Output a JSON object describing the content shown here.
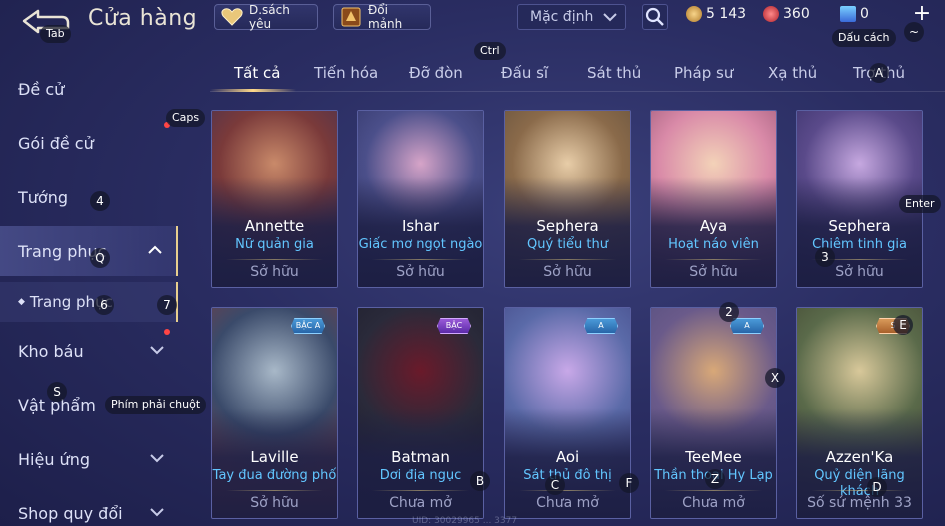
{
  "header": {
    "title": "Cửa hàng",
    "wishlist_label": "D.sách yêu",
    "fragments_label": "Đổi mảnh",
    "sort_value": "Mặc định",
    "currencies": {
      "gold": "5 143",
      "ruby": "360",
      "voucher": "0"
    },
    "plus": "+"
  },
  "tabs": [
    "Tất cả",
    "Tiến hóa",
    "Đỡ đòn",
    "Đấu sĩ",
    "Sát thủ",
    "Pháp sư",
    "Xạ thủ",
    "Trợ thủ"
  ],
  "sidebar": {
    "items": [
      "Đề cử",
      "Gói đề cử",
      "Tướng",
      "Trang phục",
      "Trang phục",
      "Kho báu",
      "Vật phẩm",
      "Hiệu ứng",
      "Shop quy đổi"
    ]
  },
  "cards": [
    {
      "hero": "Annette",
      "skin": "Nữ quản gia",
      "status": "Sở hữu",
      "colors": [
        "#7a3a3a",
        "#c98a6a",
        "#3a2f55"
      ]
    },
    {
      "hero": "Ishar",
      "skin": "Giấc mơ ngọt ngào",
      "status": "Sở hữu",
      "colors": [
        "#4b4f8a",
        "#d6a4c8",
        "#2b2f60"
      ]
    },
    {
      "hero": "Sephera",
      "skin": "Quý tiểu thư",
      "status": "Sở hữu",
      "colors": [
        "#8a6a4a",
        "#e8cda8",
        "#5a4a3a"
      ]
    },
    {
      "hero": "Aya",
      "skin": "Hoạt náo viên",
      "status": "Sở hữu",
      "colors": [
        "#d98aa8",
        "#f3d2b8",
        "#8a4a6a"
      ]
    },
    {
      "hero": "Sephera",
      "skin": "Chiêm tinh gia",
      "status": "Sở hữu",
      "colors": [
        "#5a4a8a",
        "#c6a8e0",
        "#2f2a60"
      ]
    },
    {
      "hero": "Laville",
      "skin": "Tay đua đường phố",
      "status": "Sở hữu",
      "badge": "BẬC A",
      "colors": [
        "#3a4a6a",
        "#a8b8c8",
        "#8a3a3a"
      ]
    },
    {
      "hero": "Batman",
      "skin": "Dơi địa ngục",
      "status": "Chưa mở",
      "badge": "BẬC",
      "colors": [
        "#2a2a3a",
        "#6a1a2a",
        "#1a1a28"
      ]
    },
    {
      "hero": "Aoi",
      "skin": "Sát thủ đô thị",
      "status": "Chưa mở",
      "badge": "A",
      "colors": [
        "#5a6aa8",
        "#c8a8e8",
        "#3a3a78"
      ]
    },
    {
      "hero": "TeeMee",
      "skin": "Thần thoại Hy Lạp",
      "status": "Chưa mở",
      "badge": "A",
      "colors": [
        "#6a5a8a",
        "#d8a878",
        "#4a4a7a"
      ]
    },
    {
      "hero": "Azzen'Ka",
      "skin": "Quỷ diện lãng khách",
      "status": "Số sứ mệnh 33",
      "badge": "S",
      "colors": [
        "#5a6a4a",
        "#d8c89a",
        "#3a3a2a"
      ]
    }
  ],
  "uid": "UID: 30029965 ... 3377",
  "key_hints": {
    "tab": "Tab",
    "ctrl": "Ctrl",
    "caps": "Caps",
    "space": "Dấu cách",
    "tilde": "~",
    "a": "A",
    "enter": "Enter",
    "right_click": "Phím phải chuột",
    "k4": "4",
    "q": "Q",
    "k6": "6",
    "k7": "7",
    "k3": "3",
    "k2": "2",
    "e": "E",
    "s": "S",
    "x": "X",
    "b": "B",
    "c": "C",
    "f": "F",
    "z": "Z",
    "d": "D"
  }
}
